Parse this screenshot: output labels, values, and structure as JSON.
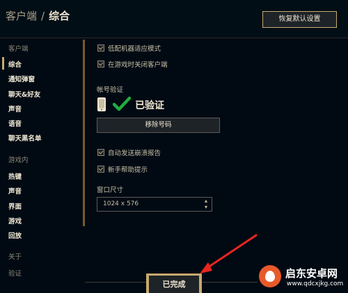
{
  "header": {
    "breadcrumb_root": "客户端",
    "separator": "/",
    "breadcrumb_current": "综合",
    "restore_defaults_label": "恢复默认设置"
  },
  "sidebar": {
    "client_heading": "客户端",
    "client_items": [
      "综合",
      "通知弹窗",
      "聊天&好友",
      "声音",
      "语音",
      "聊天黑名单"
    ],
    "ingame_heading": "游戏内",
    "ingame_items": [
      "热键",
      "声音",
      "界面",
      "游戏",
      "回放"
    ],
    "about_heading": "关于",
    "about_items": [
      "验证"
    ],
    "active_item": "综合"
  },
  "general": {
    "low_spec_mode": {
      "label": "低配机器适应模式",
      "checked": true
    },
    "close_client_ingame": {
      "label": "在游戏时关闭客户端",
      "checked": true
    },
    "account_verification_title": "帐号验证",
    "verified_text": "已验证",
    "unlink_button_label": "移除号码",
    "auto_crash_report": {
      "label": "自动发送崩溃报告",
      "checked": true
    },
    "newbie_tips": {
      "label": "新手帮助提示",
      "checked": true
    },
    "window_size_title": "窗口尺寸",
    "window_size_value": "1024 x 576"
  },
  "footer": {
    "done_label": "已完成"
  },
  "icons": {
    "phone": "phone-icon",
    "check": "checkmark-icon",
    "dropdown": "updown-arrows-icon"
  },
  "colors": {
    "background": "#010a13",
    "gold_accent": "#c8aa6e",
    "check_green": "#1fae3c",
    "annotation_red": "#e8261f",
    "watermark_orange": "#e85a2a"
  },
  "watermark": {
    "title": "启东安卓网",
    "url": "www.qdcxjkg.com"
  }
}
